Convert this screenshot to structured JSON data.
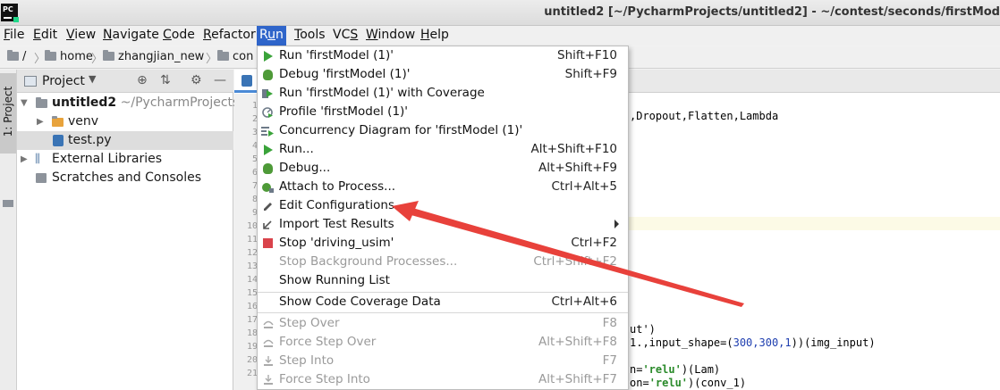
{
  "window": {
    "title": "untitled2 [~/PycharmProjects/untitled2] - ~/contest/seconds/firstMod",
    "app_icon_text": "PC"
  },
  "menubar": [
    {
      "pre": "",
      "u": "F",
      "post": "ile"
    },
    {
      "pre": "",
      "u": "E",
      "post": "dit"
    },
    {
      "pre": "",
      "u": "V",
      "post": "iew"
    },
    {
      "pre": "",
      "u": "N",
      "post": "avigate"
    },
    {
      "pre": "",
      "u": "C",
      "post": "ode"
    },
    {
      "pre": "",
      "u": "R",
      "post": "efactor"
    },
    {
      "pre": "R",
      "u": "u",
      "post": "n"
    },
    {
      "pre": "",
      "u": "T",
      "post": "ools"
    },
    {
      "pre": "VC",
      "u": "S",
      "post": ""
    },
    {
      "pre": "",
      "u": "W",
      "post": "indow"
    },
    {
      "pre": "",
      "u": "H",
      "post": "elp"
    }
  ],
  "breadcrumb": [
    "/",
    "home",
    "zhangjian_new",
    "con"
  ],
  "left_stripe": {
    "label": "1: Project"
  },
  "project_panel": {
    "title": "Project",
    "tree": [
      {
        "label": "untitled2",
        "hint": "~/PycharmProjects/u",
        "expanded": true
      },
      {
        "label": "venv",
        "expanded": false
      },
      {
        "label": "test.py"
      },
      {
        "label": "External Libraries",
        "expanded": false
      },
      {
        "label": "Scratches and Consoles"
      }
    ]
  },
  "editor": {
    "line_numbers": [
      "1",
      "2",
      "3",
      "4",
      "5",
      "6",
      "7",
      "8",
      "9",
      "10",
      "11",
      "12",
      "13",
      "14",
      "15",
      "16",
      "17",
      "18",
      "19",
      "20",
      "21"
    ],
    "code_lines": [
      {
        "text": ",Dropout,Flatten,Lambda"
      },
      {
        "pre": "ut",
        "str": "",
        "post": "')"
      },
      {
        "pre": "1.,input_shape=(",
        "num": "300,300,1",
        "post": "))(img_input)"
      },
      {
        "pre": "n=",
        "str": "'relu'",
        "post": ")(Lam)"
      },
      {
        "pre": "on=",
        "str": "'relu'",
        "post": ")(conv_1)"
      }
    ]
  },
  "run_menu": {
    "items": [
      {
        "label": "Run 'firstModel (1)'",
        "shortcut": "Shift+F10",
        "icon": "run-icon",
        "disabled": false
      },
      {
        "label": "Debug 'firstModel (1)'",
        "shortcut": "Shift+F9",
        "icon": "debug-icon",
        "disabled": false
      },
      {
        "label": "Run 'firstModel (1)' with Coverage",
        "shortcut": "",
        "icon": "coverage-icon",
        "disabled": false
      },
      {
        "label": "Profile 'firstModel (1)'",
        "shortcut": "",
        "icon": "profile-icon",
        "disabled": false
      },
      {
        "label": "Concurrency Diagram for 'firstModel (1)'",
        "shortcut": "",
        "icon": "concurrency-icon",
        "disabled": false
      },
      {
        "label": "Run...",
        "shortcut": "Alt+Shift+F10",
        "icon": "run-icon",
        "disabled": false
      },
      {
        "label": "Debug...",
        "shortcut": "Alt+Shift+F9",
        "icon": "debug-icon",
        "disabled": false
      },
      {
        "label": "Attach to Process...",
        "shortcut": "Ctrl+Alt+5",
        "icon": "attach-icon",
        "disabled": false
      },
      {
        "label": "Edit Configurations...",
        "shortcut": "",
        "icon": "edit-icon",
        "disabled": false
      },
      {
        "label": "Import Test Results",
        "shortcut": "",
        "icon": "import-icon",
        "disabled": false,
        "submenu": true
      },
      {
        "label": "Stop 'driving_usim'",
        "shortcut": "Ctrl+F2",
        "icon": "stop-icon",
        "disabled": false
      },
      {
        "label": "Stop Background Processes...",
        "shortcut": "Ctrl+Shift+F2",
        "icon": "",
        "disabled": true
      },
      {
        "label": "Show Running List",
        "shortcut": "",
        "icon": "",
        "disabled": false
      },
      {
        "label": "Show Code Coverage Data",
        "shortcut": "Ctrl+Alt+6",
        "icon": "",
        "disabled": false
      },
      {
        "label": "Step Over",
        "shortcut": "F8",
        "icon": "step-over-icon",
        "disabled": true
      },
      {
        "label": "Force Step Over",
        "shortcut": "Alt+Shift+F8",
        "icon": "force-step-over-icon",
        "disabled": true
      },
      {
        "label": "Step Into",
        "shortcut": "F7",
        "icon": "step-into-icon",
        "disabled": true
      },
      {
        "label": "Force Step Into",
        "shortcut": "Alt+Shift+F7",
        "icon": "force-step-into-icon",
        "disabled": true
      }
    ]
  },
  "colors": {
    "menu_highlight": "#2f65ca",
    "annotation_arrow": "#e8413b",
    "run_green": "#3aa33a",
    "stop_red": "#d9434b"
  }
}
